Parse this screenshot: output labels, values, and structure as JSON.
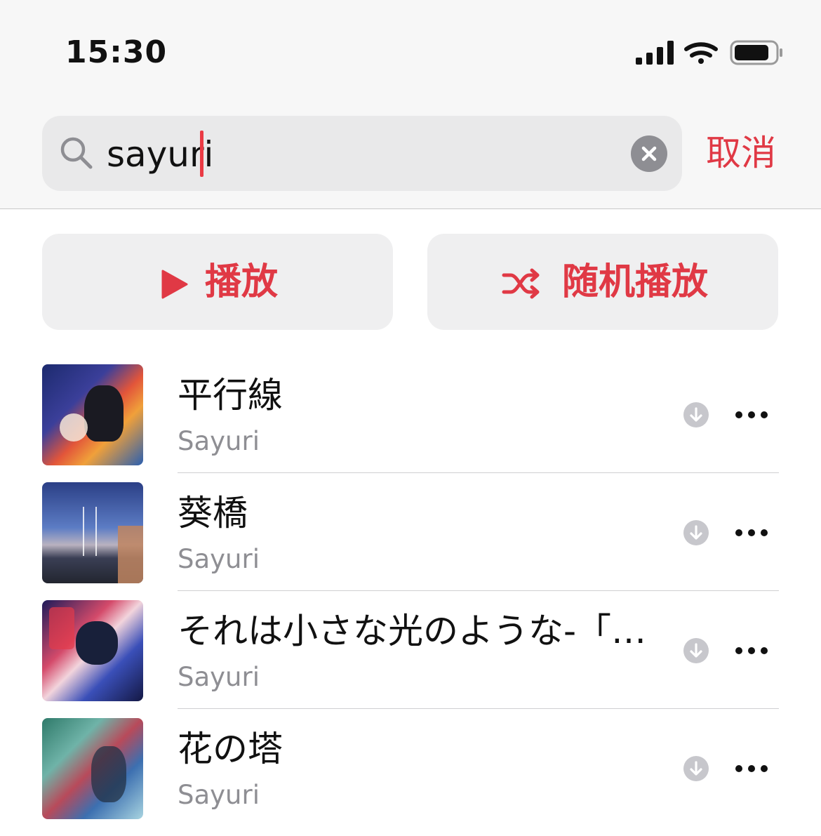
{
  "status_bar": {
    "time": "15:30"
  },
  "search": {
    "query": "sayuri",
    "cancel_label": "取消"
  },
  "actions": {
    "play_label": "播放",
    "shuffle_label": "随机播放"
  },
  "songs": [
    {
      "title": "平行線",
      "artist": "Sayuri"
    },
    {
      "title": "葵橋",
      "artist": "Sayuri"
    },
    {
      "title": "それは小さな光のような-「…",
      "artist": "Sayuri"
    },
    {
      "title": "花の塔",
      "artist": "Sayuri"
    }
  ],
  "colors": {
    "accent": "#e03945",
    "secondary_text": "#8e8e93",
    "field_bg": "#e9e9ea"
  },
  "icons": [
    "search-icon",
    "clear-icon",
    "play-icon",
    "shuffle-icon",
    "download-icon",
    "more-icon",
    "signal-icon",
    "wifi-icon",
    "battery-icon"
  ]
}
